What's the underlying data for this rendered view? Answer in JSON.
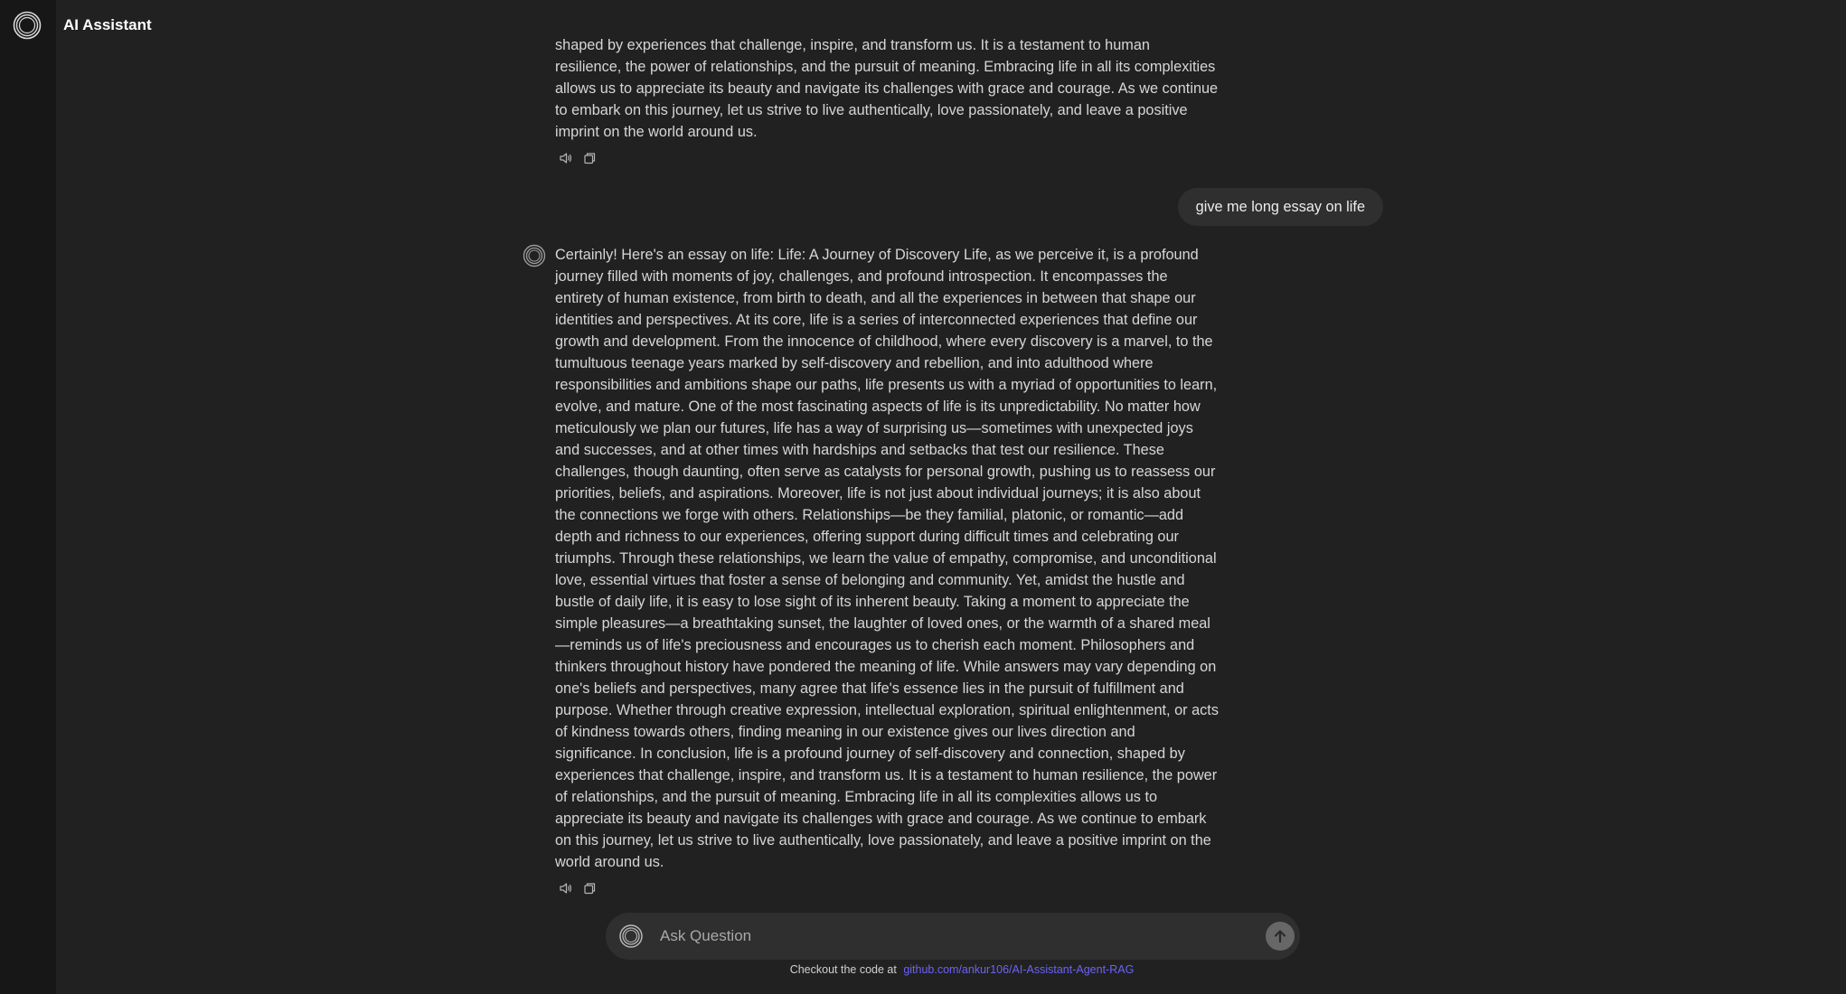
{
  "app": {
    "title": "AI Assistant"
  },
  "conversation": {
    "previous_response_tail": "shaped by experiences that challenge, inspire, and transform us. It is a testament to human resilience, the power of relationships, and the pursuit of meaning. Embracing life in all its complexities allows us to appreciate its beauty and navigate its challenges with grace and courage. As we continue to embark on this journey, let us strive to live authentically, love passionately, and leave a positive imprint on the world around us.",
    "user_message": "give me long essay on life",
    "assistant_response": "Certainly! Here's an essay on life: Life: A Journey of Discovery Life, as we perceive it, is a profound journey filled with moments of joy, challenges, and profound introspection. It encompasses the entirety of human existence, from birth to death, and all the experiences in between that shape our identities and perspectives. At its core, life is a series of interconnected experiences that define our growth and development. From the innocence of childhood, where every discovery is a marvel, to the tumultuous teenage years marked by self-discovery and rebellion, and into adulthood where responsibilities and ambitions shape our paths, life presents us with a myriad of opportunities to learn, evolve, and mature. One of the most fascinating aspects of life is its unpredictability. No matter how meticulously we plan our futures, life has a way of surprising us—sometimes with unexpected joys and successes, and at other times with hardships and setbacks that test our resilience. These challenges, though daunting, often serve as catalysts for personal growth, pushing us to reassess our priorities, beliefs, and aspirations. Moreover, life is not just about individual journeys; it is also about the connections we forge with others. Relationships—be they familial, platonic, or romantic—add depth and richness to our experiences, offering support during difficult times and celebrating our triumphs. Through these relationships, we learn the value of empathy, compromise, and unconditional love, essential virtues that foster a sense of belonging and community. Yet, amidst the hustle and bustle of daily life, it is easy to lose sight of its inherent beauty. Taking a moment to appreciate the simple pleasures—a breathtaking sunset, the laughter of loved ones, or the warmth of a shared meal—reminds us of life's preciousness and encourages us to cherish each moment. Philosophers and thinkers throughout history have pondered the meaning of life. While answers may vary depending on one's beliefs and perspectives, many agree that life's essence lies in the pursuit of fulfillment and purpose. Whether through creative expression, intellectual exploration, spiritual enlightenment, or acts of kindness towards others, finding meaning in our existence gives our lives direction and significance. In conclusion, life is a profound journey of self-discovery and connection, shaped by experiences that challenge, inspire, and transform us. It is a testament to human resilience, the power of relationships, and the pursuit of meaning. Embracing life in all its complexities allows us to appreciate its beauty and navigate its challenges with grace and courage. As we continue to embark on this journey, let us strive to live authentically, love passionately, and leave a positive imprint on the world around us."
  },
  "message_actions": {
    "read_aloud_icon": "speaker-icon",
    "copy_icon": "copy-icon"
  },
  "composer": {
    "placeholder": "Ask Question",
    "send_icon": "arrow-up-icon"
  },
  "footer": {
    "prefix": "Checkout the code at",
    "link_text": "github.com/ankur106/AI-Assistant-Agent-RAG"
  },
  "colors": {
    "background": "#212121",
    "sidebar": "#171717",
    "bubble": "#2f2f2f",
    "link": "#6b63f5"
  }
}
